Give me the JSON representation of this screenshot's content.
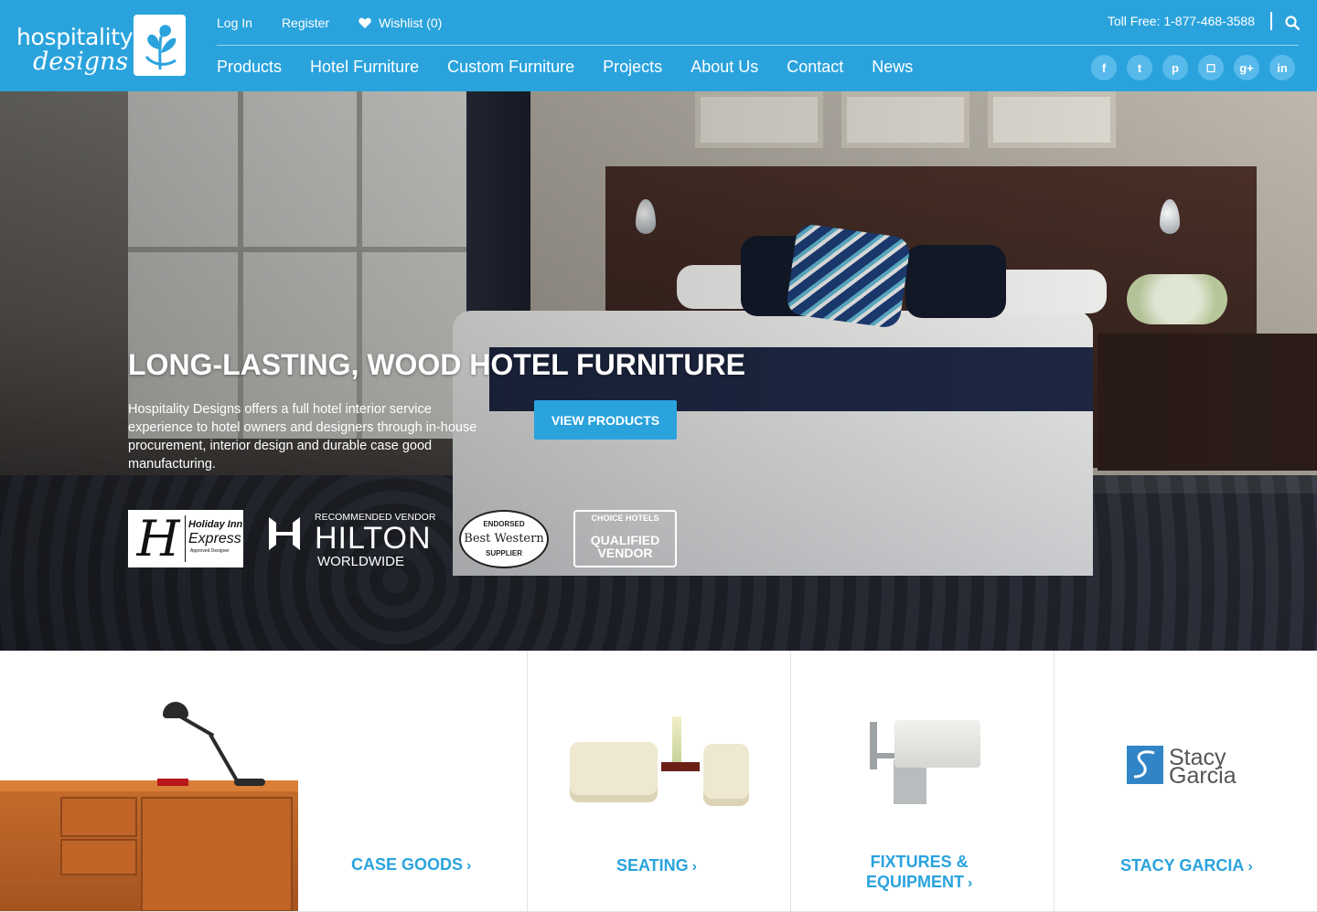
{
  "brand": {
    "logo_line1": "hospitality",
    "logo_line2": "designs"
  },
  "top_bar": {
    "login": "Log In",
    "register": "Register",
    "wishlist": "Wishlist (0)",
    "toll_free": "Toll Free: 1-877-468-3588",
    "divider": "|"
  },
  "nav": {
    "items": [
      "Products",
      "Hotel Furniture",
      "Custom Furniture",
      "Projects",
      "About Us",
      "Contact",
      "News"
    ]
  },
  "social": {
    "icons": [
      "facebook-icon",
      "twitter-icon",
      "pinterest-icon",
      "instagram-icon",
      "google-plus-icon",
      "linkedin-icon"
    ],
    "glyphs": [
      "f",
      "t",
      "p",
      "◻",
      "g+",
      "in"
    ]
  },
  "hero": {
    "title": "LONG-LASTING, WOOD HOTEL FURNITURE",
    "description": "Hospitality Designs offers a full hotel interior service experience to hotel owners and designers through in-house procurement, interior design and durable case good manufacturing.",
    "button": "VIEW PRODUCTS"
  },
  "badges": {
    "holiday_inn": {
      "h": "H",
      "line1": "Holiday Inn",
      "line2": "Express",
      "line3": "Approved Designer"
    },
    "hilton": {
      "recommended": "RECOMMENDED VENDOR",
      "name": "HILTON",
      "worldwide": "WORLDWIDE"
    },
    "best_western": {
      "endorsed": "ENDORSED",
      "name": "Best Western",
      "supplier": "SUPPLIER"
    },
    "choice": {
      "brand": "CHOICE HOTELS",
      "qualified": "QUALIFIED",
      "vendor": "VENDOR"
    }
  },
  "categories": [
    {
      "label": "CASE GOODS",
      "chevron": "›"
    },
    {
      "label": "SEATING",
      "chevron": "›"
    },
    {
      "label_line1": "FIXTURES &",
      "label_line2": "EQUIPMENT",
      "chevron": "›"
    },
    {
      "label": "STACY GARCIA",
      "chevron": "›",
      "logo_line1": "Stacy",
      "logo_line2": "Garcia"
    }
  ],
  "colors": {
    "accent": "#2aa3dd",
    "header_bg": "#2aa3dd",
    "social_circle": "#58baeb"
  }
}
